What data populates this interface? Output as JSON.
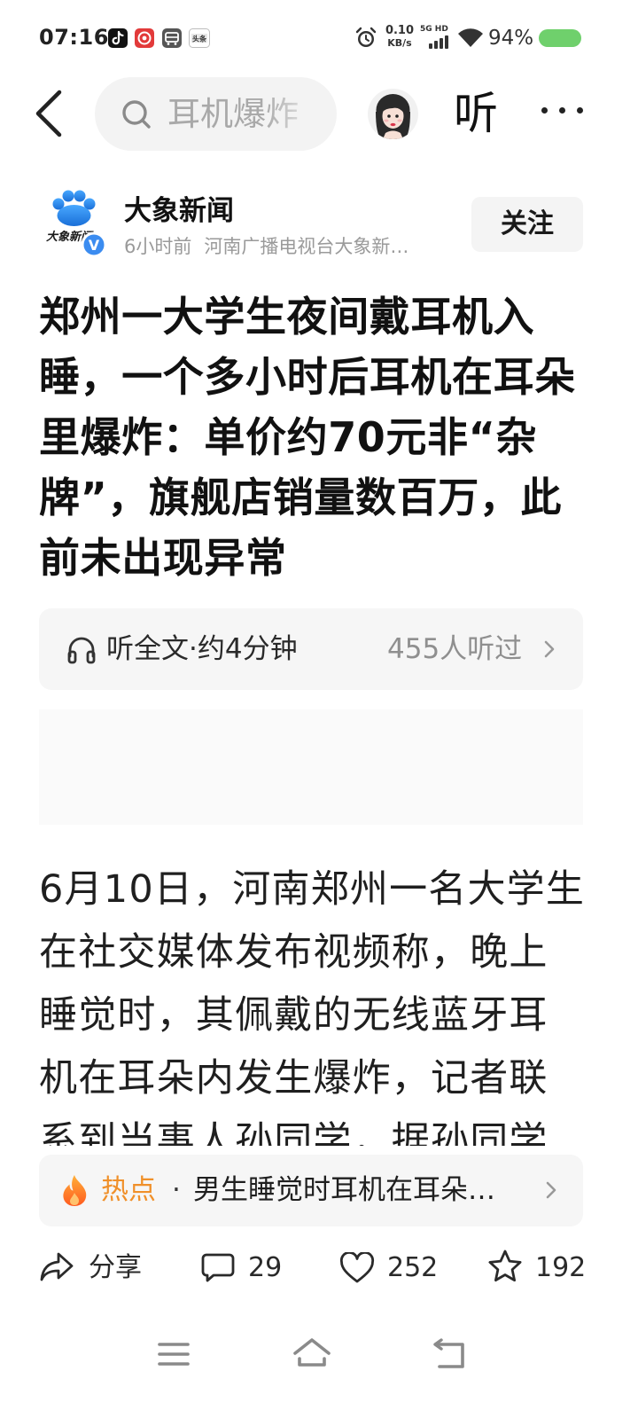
{
  "status_bar": {
    "time": "07:16",
    "app_icons": [
      "tiktok-icon",
      "red-app-icon",
      "card-app-icon",
      "toutiao-icon"
    ],
    "toutiao_icon_text": "头条",
    "net_speed": "0.10",
    "net_speed_unit": "KB/s",
    "network_type": "5G HD",
    "battery": "94%",
    "battery_level": 0.94
  },
  "header": {
    "search_query": "耳机爆炸",
    "listen_button": "听",
    "icons": [
      "back-icon",
      "search-icon",
      "avatar",
      "more-icon"
    ]
  },
  "author": {
    "logo_text": "大象新闻",
    "name": "大象新闻",
    "time": "6小时前",
    "source": "河南广播电视台大象新…",
    "follow_button": "关注",
    "verified_mark": "V"
  },
  "article": {
    "title_lines": [
      "郑州一大学生夜间戴耳机入",
      "睡，一个多小时后耳机在耳朵",
      "里爆炸：单价约70元非“杂",
      "牌”，旗舰店销量数百万，此",
      "前未出现异常"
    ],
    "body_lines": [
      "6月10日，河南郑州一名大学生",
      "在社交媒体发布视频称，晚上",
      "睡觉时，其佩戴的无线蓝牙耳",
      "机在耳朵内发生爆炸，记者联",
      "系到当事人孙同学，据孙同学"
    ]
  },
  "listen_bar": {
    "label": "听全文·约4分钟",
    "listeners": "455人听过"
  },
  "hot_bar": {
    "tag": "热点",
    "separator": "·",
    "text": "男生睡觉时耳机在耳朵…"
  },
  "actions": {
    "share": "分享",
    "comments": "29",
    "likes": "252",
    "favorites": "192"
  },
  "nav_bar": {
    "icons": [
      "menu-icon",
      "home-icon",
      "back-icon"
    ]
  },
  "colors": {
    "hot_accent": "#f0902a",
    "verified_blue": "#3b8cf0",
    "battery_green": "#6fd06c",
    "panel_bg": "#f6f6f6"
  }
}
